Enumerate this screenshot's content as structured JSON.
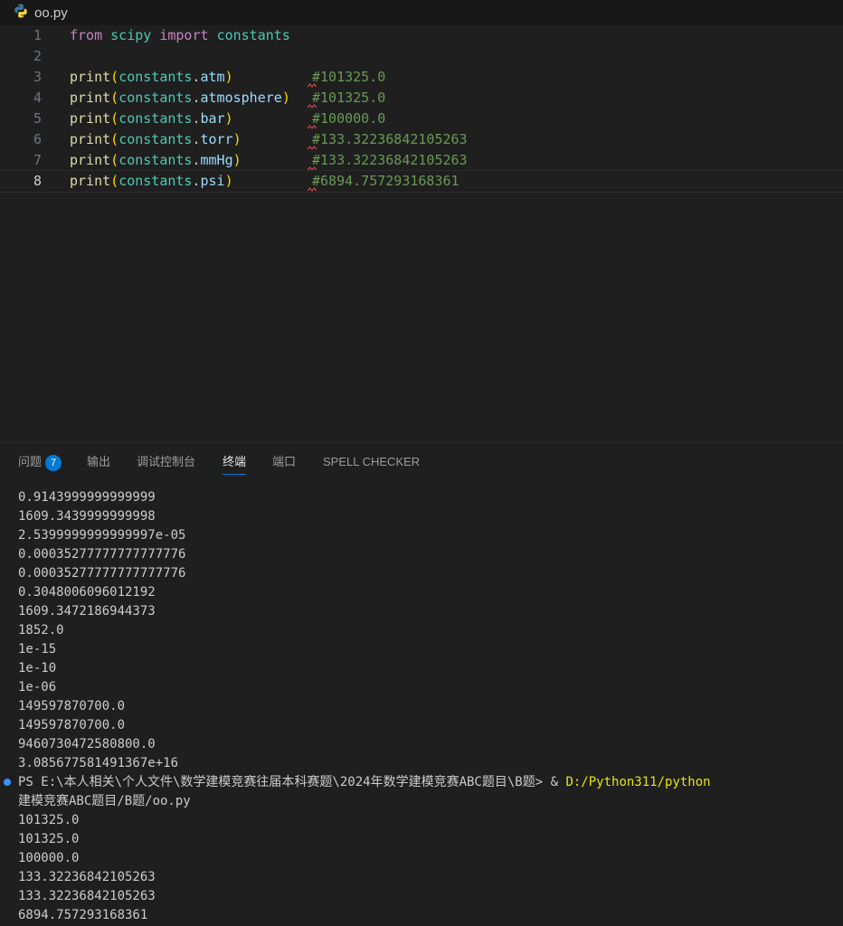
{
  "tab": {
    "filename": "oo.py",
    "icon": "python-icon"
  },
  "editor": {
    "current_line": 8,
    "lines": [
      {
        "n": "1",
        "tokens": [
          {
            "t": "from",
            "c": "kw"
          },
          {
            "t": " "
          },
          {
            "t": "scipy",
            "c": "mod"
          },
          {
            "t": " "
          },
          {
            "t": "import",
            "c": "kw"
          },
          {
            "t": " "
          },
          {
            "t": "constants",
            "c": "mod"
          }
        ],
        "comment": ""
      },
      {
        "n": "2",
        "tokens": [],
        "comment": ""
      },
      {
        "n": "3",
        "tokens": [
          {
            "t": "print",
            "c": "fn"
          },
          {
            "t": "(",
            "c": "p"
          },
          {
            "t": "constants",
            "c": "mod"
          },
          {
            "t": "."
          },
          {
            "t": "atm",
            "c": "attr"
          },
          {
            "t": ")",
            "c": "p"
          }
        ],
        "comment": "#101325.0"
      },
      {
        "n": "4",
        "tokens": [
          {
            "t": "print",
            "c": "fn"
          },
          {
            "t": "(",
            "c": "p"
          },
          {
            "t": "constants",
            "c": "mod"
          },
          {
            "t": "."
          },
          {
            "t": "atmosphere",
            "c": "attr"
          },
          {
            "t": ")",
            "c": "p"
          }
        ],
        "comment": "#101325.0"
      },
      {
        "n": "5",
        "tokens": [
          {
            "t": "print",
            "c": "fn"
          },
          {
            "t": "(",
            "c": "p"
          },
          {
            "t": "constants",
            "c": "mod"
          },
          {
            "t": "."
          },
          {
            "t": "bar",
            "c": "attr"
          },
          {
            "t": ")",
            "c": "p"
          }
        ],
        "comment": "#100000.0"
      },
      {
        "n": "6",
        "tokens": [
          {
            "t": "print",
            "c": "fn"
          },
          {
            "t": "(",
            "c": "p"
          },
          {
            "t": "constants",
            "c": "mod"
          },
          {
            "t": "."
          },
          {
            "t": "torr",
            "c": "attr"
          },
          {
            "t": ")",
            "c": "p"
          }
        ],
        "comment": "#133.32236842105263"
      },
      {
        "n": "7",
        "tokens": [
          {
            "t": "print",
            "c": "fn"
          },
          {
            "t": "(",
            "c": "p"
          },
          {
            "t": "constants",
            "c": "mod"
          },
          {
            "t": "."
          },
          {
            "t": "mmHg",
            "c": "attr"
          },
          {
            "t": ")",
            "c": "p"
          }
        ],
        "comment": "#133.32236842105263"
      },
      {
        "n": "8",
        "tokens": [
          {
            "t": "print",
            "c": "fn"
          },
          {
            "t": "(",
            "c": "p"
          },
          {
            "t": "constants",
            "c": "mod"
          },
          {
            "t": "."
          },
          {
            "t": "psi",
            "c": "attr"
          },
          {
            "t": ")",
            "c": "p"
          }
        ],
        "comment": "#6894.757293168361"
      }
    ]
  },
  "panel": {
    "tabs": [
      {
        "label": "问题",
        "badge": "7",
        "active": false
      },
      {
        "label": "输出",
        "active": false
      },
      {
        "label": "调试控制台",
        "active": false
      },
      {
        "label": "终端",
        "active": true
      },
      {
        "label": "端口",
        "active": false
      },
      {
        "label": "SPELL CHECKER",
        "active": false
      }
    ]
  },
  "terminal": {
    "prev_output": [
      "0.9143999999999999",
      "1609.3439999999998",
      "2.5399999999999997e-05",
      "0.00035277777777777776",
      "0.00035277777777777776",
      "0.3048006096012192",
      "1609.3472186944373",
      "1852.0",
      "1e-15",
      "1e-10",
      "1e-06",
      "149597870700.0",
      "149597870700.0",
      "9460730472580800.0",
      "3.085677581491367e+16"
    ],
    "prompt": "PS E:\\本人相关\\个人文件\\数学建模竞赛往届本科赛题\\2024年数学建模竞赛ABC题目\\B题> & ",
    "command_path": "D:/Python311/python",
    "prompt_wrap": "建模竞赛ABC题目/B题/oo.py",
    "output": [
      "101325.0",
      "101325.0",
      "100000.0",
      "133.32236842105263",
      "133.32236842105263",
      "6894.757293168361"
    ]
  },
  "colors": {
    "background": "#1f1f1f",
    "keyword": "#c586c0",
    "function": "#dcdcaa",
    "module": "#4ec9b0",
    "attribute": "#9cdcfe",
    "bracket": "#ffd700",
    "comment": "#6a9955",
    "accent": "#0078d4"
  }
}
